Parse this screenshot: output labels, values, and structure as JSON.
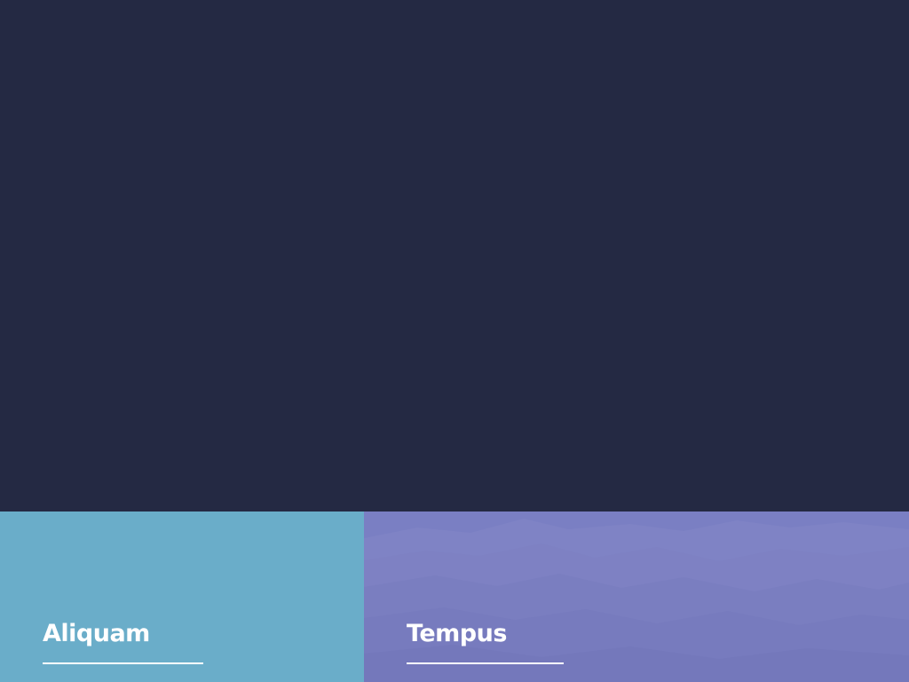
{
  "tiles": [
    {
      "title": "Aliquam",
      "color": "#6aadc9"
    },
    {
      "title": "Tempus",
      "color": "#7a7fc3"
    }
  ],
  "colors": {
    "background": "#242943",
    "text": "#ffffff"
  }
}
